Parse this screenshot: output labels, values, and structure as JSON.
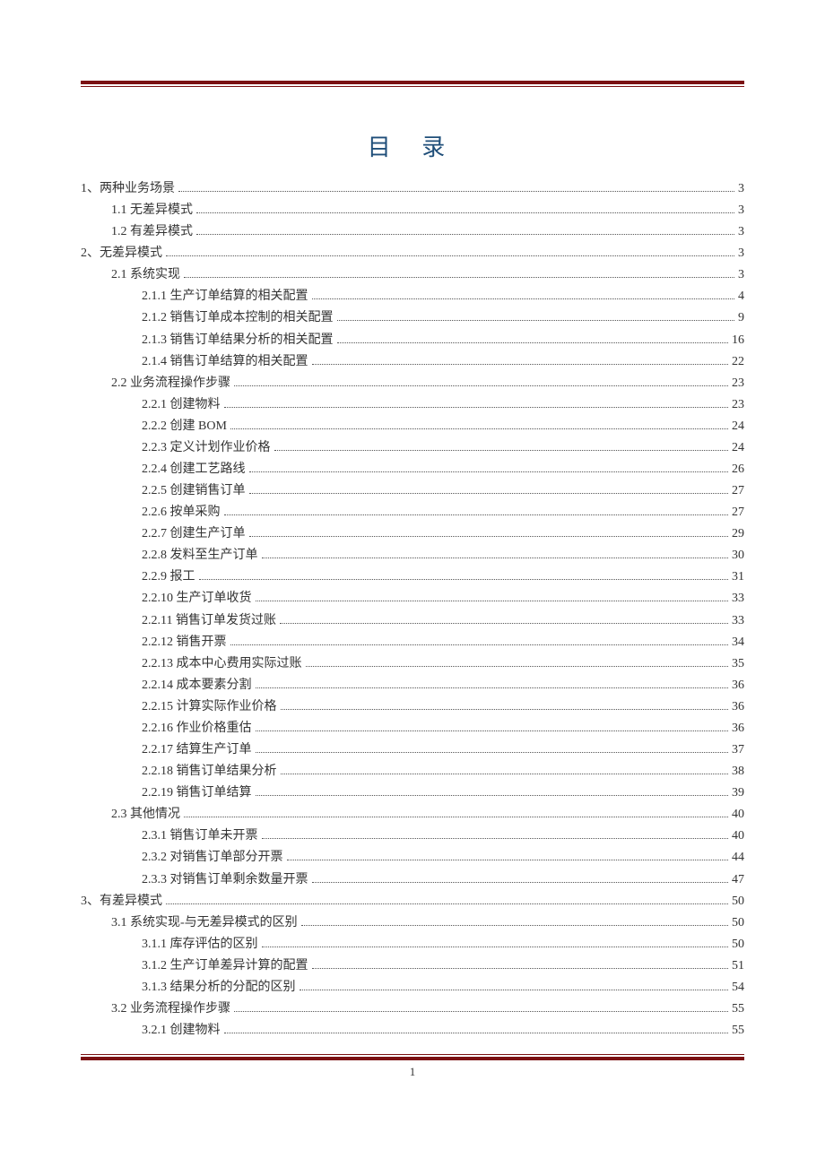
{
  "title": "目 录",
  "footer_page": "1",
  "toc": [
    {
      "level": 0,
      "label": "1、两种业务场景",
      "page": "3"
    },
    {
      "level": 1,
      "label": "1.1 无差异模式",
      "page": "3"
    },
    {
      "level": 1,
      "label": "1.2 有差异模式",
      "page": "3"
    },
    {
      "level": 0,
      "label": "2、无差异模式",
      "page": "3"
    },
    {
      "level": 1,
      "label": "2.1 系统实现",
      "page": "3"
    },
    {
      "level": 2,
      "label": "2.1.1 生产订单结算的相关配置",
      "page": "4"
    },
    {
      "level": 2,
      "label": "2.1.2 销售订单成本控制的相关配置",
      "page": "9"
    },
    {
      "level": 2,
      "label": "2.1.3 销售订单结果分析的相关配置",
      "page": "16"
    },
    {
      "level": 2,
      "label": "2.1.4 销售订单结算的相关配置",
      "page": "22"
    },
    {
      "level": 1,
      "label": "2.2 业务流程操作步骤",
      "page": "23"
    },
    {
      "level": 2,
      "label": "2.2.1 创建物料",
      "page": "23"
    },
    {
      "level": 2,
      "label": "2.2.2 创建 BOM",
      "page": "24"
    },
    {
      "level": 2,
      "label": "2.2.3 定义计划作业价格",
      "page": "24"
    },
    {
      "level": 2,
      "label": "2.2.4 创建工艺路线",
      "page": "26"
    },
    {
      "level": 2,
      "label": "2.2.5 创建销售订单",
      "page": "27"
    },
    {
      "level": 2,
      "label": "2.2.6 按单采购",
      "page": "27"
    },
    {
      "level": 2,
      "label": "2.2.7 创建生产订单",
      "page": "29"
    },
    {
      "level": 2,
      "label": "2.2.8 发料至生产订单",
      "page": "30"
    },
    {
      "level": 2,
      "label": "2.2.9 报工",
      "page": "31"
    },
    {
      "level": 2,
      "label": "2.2.10 生产订单收货",
      "page": "33"
    },
    {
      "level": 2,
      "label": "2.2.11 销售订单发货过账",
      "page": "33"
    },
    {
      "level": 2,
      "label": "2.2.12 销售开票",
      "page": "34"
    },
    {
      "level": 2,
      "label": "2.2.13 成本中心费用实际过账",
      "page": "35"
    },
    {
      "level": 2,
      "label": "2.2.14 成本要素分割",
      "page": "36"
    },
    {
      "level": 2,
      "label": "2.2.15 计算实际作业价格",
      "page": "36"
    },
    {
      "level": 2,
      "label": "2.2.16 作业价格重估",
      "page": "36"
    },
    {
      "level": 2,
      "label": "2.2.17 结算生产订单",
      "page": "37"
    },
    {
      "level": 2,
      "label": "2.2.18 销售订单结果分析",
      "page": "38"
    },
    {
      "level": 2,
      "label": "2.2.19 销售订单结算",
      "page": "39"
    },
    {
      "level": 1,
      "label": "2.3 其他情况",
      "page": "40"
    },
    {
      "level": 2,
      "label": "2.3.1 销售订单未开票",
      "page": "40"
    },
    {
      "level": 2,
      "label": "2.3.2 对销售订单部分开票",
      "page": "44"
    },
    {
      "level": 2,
      "label": "2.3.3 对销售订单剩余数量开票",
      "page": "47"
    },
    {
      "level": 0,
      "label": "3、有差异模式",
      "page": "50"
    },
    {
      "level": 1,
      "label": "3.1 系统实现-与无差异模式的区别",
      "page": "50"
    },
    {
      "level": 2,
      "label": "3.1.1 库存评估的区别",
      "page": "50"
    },
    {
      "level": 2,
      "label": "3.1.2 生产订单差异计算的配置",
      "page": "51"
    },
    {
      "level": 2,
      "label": "3.1.3 结果分析的分配的区别",
      "page": "54"
    },
    {
      "level": 1,
      "label": "3.2 业务流程操作步骤",
      "page": "55"
    },
    {
      "level": 2,
      "label": "3.2.1 创建物料",
      "page": "55"
    }
  ]
}
